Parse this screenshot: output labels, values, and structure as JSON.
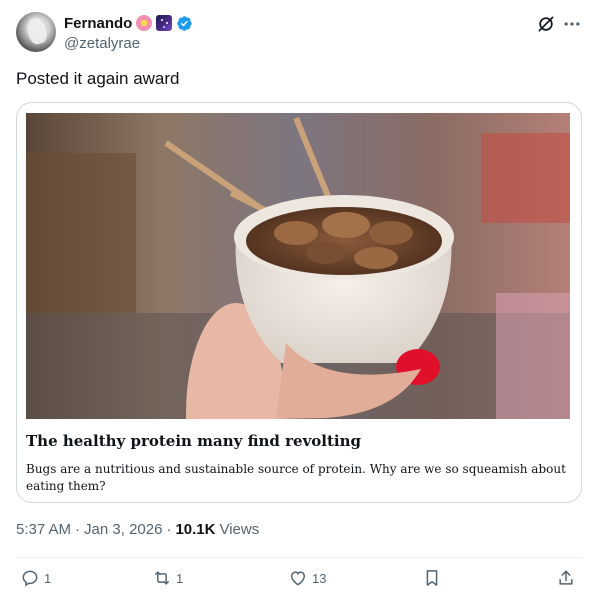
{
  "author": {
    "display_name": "Fernando",
    "handle": "@zetalyrae",
    "emoji_icons": [
      "cherry-blossom-emoji",
      "milky-way-emoji"
    ],
    "verified": true,
    "verified_color": "#1d9bf0"
  },
  "post": {
    "text": "Posted it again award"
  },
  "link_card": {
    "title": "The healthy protein many find revolting",
    "description": "Bugs are a nutritious and sustainable source of protein. Why are we so squeamish about eating them?",
    "image_description": "hand-holding-cup-of-fried-silkworm-pupae-icon"
  },
  "meta": {
    "time": "5:37 AM",
    "separator": "·",
    "date": "Jan 3, 2026",
    "separator2": "·",
    "views_count": "10.1K",
    "views_label": "Views"
  },
  "actions": {
    "reply_count": "1",
    "repost_count": "1",
    "like_count": "13"
  },
  "colors": {
    "text_primary": "#0f1419",
    "text_secondary": "#536471",
    "border": "#cfd9de",
    "nail_red": "#e0102a"
  }
}
